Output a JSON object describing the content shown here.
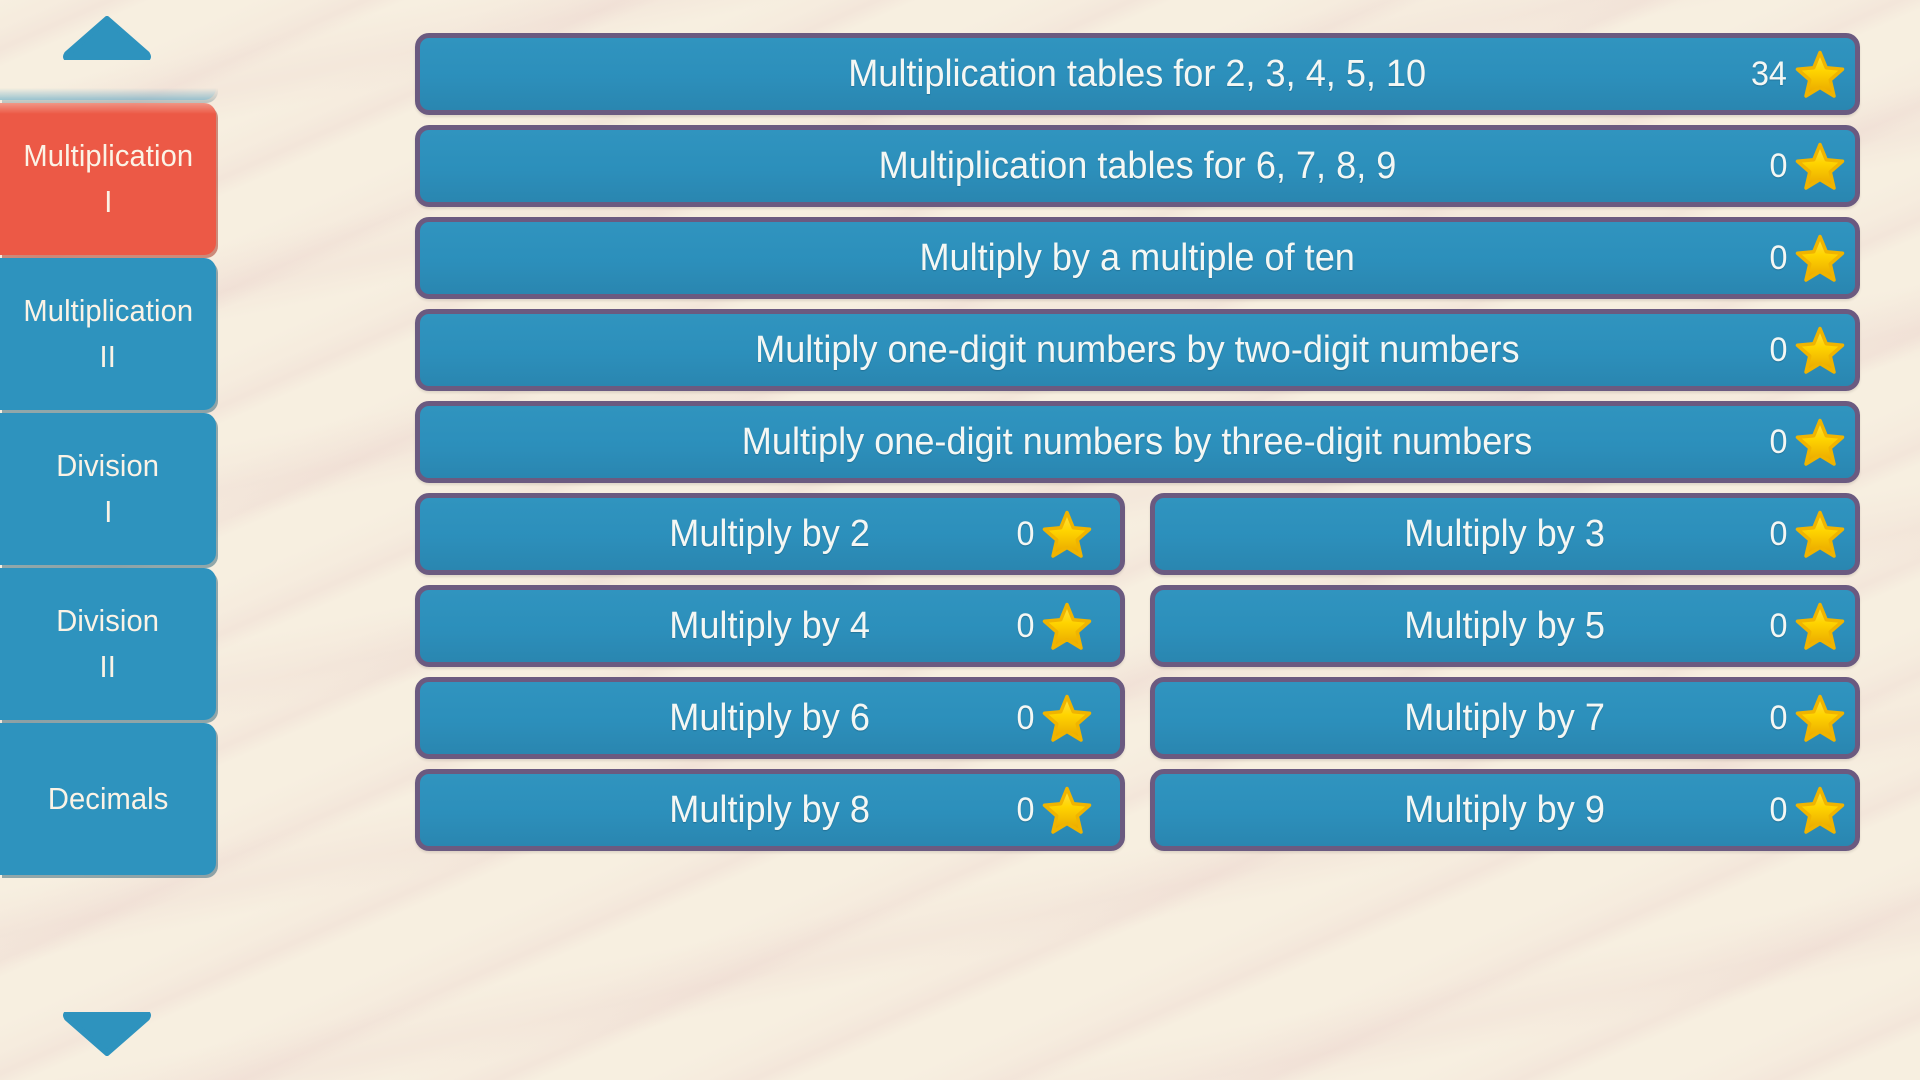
{
  "theme": {
    "background": "#F7EFE0",
    "tile_blue": "#2E93BE",
    "tile_active_red": "#EC5946",
    "button_fill": "#2F92BC",
    "button_border": "#6B5A80",
    "text_cream": "#FBF3E6",
    "star_gold": "#FFD400",
    "star_gold_dark": "#E5A400"
  },
  "sidebar": {
    "scroll_up_label": "Scroll up",
    "scroll_down_label": "Scroll down",
    "items": [
      {
        "line1": "Multiplication",
        "line2": "I",
        "active": true,
        "partial": false
      },
      {
        "line1": "Multiplication",
        "line2": "II",
        "active": false,
        "partial": false
      },
      {
        "line1": "Division",
        "line2": "I",
        "active": false,
        "partial": false
      },
      {
        "line1": "Division",
        "line2": "II",
        "active": false,
        "partial": false
      },
      {
        "line1": "Decimals",
        "line2": "",
        "active": false,
        "partial": false
      }
    ]
  },
  "main": {
    "star_icon": "star-icon",
    "rows": [
      {
        "columns": [
          {
            "label": "Multiplication tables for 2, 3, 4, 5, 10",
            "score": "34"
          }
        ]
      },
      {
        "columns": [
          {
            "label": "Multiplication tables for 6, 7, 8, 9",
            "score": "0"
          }
        ]
      },
      {
        "columns": [
          {
            "label": "Multiply by a multiple of ten",
            "score": "0"
          }
        ]
      },
      {
        "columns": [
          {
            "label": "Multiply one-digit numbers by two-digit numbers",
            "score": "0"
          }
        ]
      },
      {
        "columns": [
          {
            "label": "Multiply one-digit numbers by three-digit numbers",
            "score": "0"
          }
        ]
      },
      {
        "columns": [
          {
            "label": "Multiply by 2",
            "score": "0"
          },
          {
            "label": "Multiply by 3",
            "score": "0"
          }
        ]
      },
      {
        "columns": [
          {
            "label": "Multiply by 4",
            "score": "0"
          },
          {
            "label": "Multiply by 5",
            "score": "0"
          }
        ]
      },
      {
        "columns": [
          {
            "label": "Multiply by 6",
            "score": "0"
          },
          {
            "label": "Multiply by 7",
            "score": "0"
          }
        ]
      },
      {
        "columns": [
          {
            "label": "Multiply by 8",
            "score": "0"
          },
          {
            "label": "Multiply by 9",
            "score": "0"
          }
        ]
      }
    ]
  }
}
